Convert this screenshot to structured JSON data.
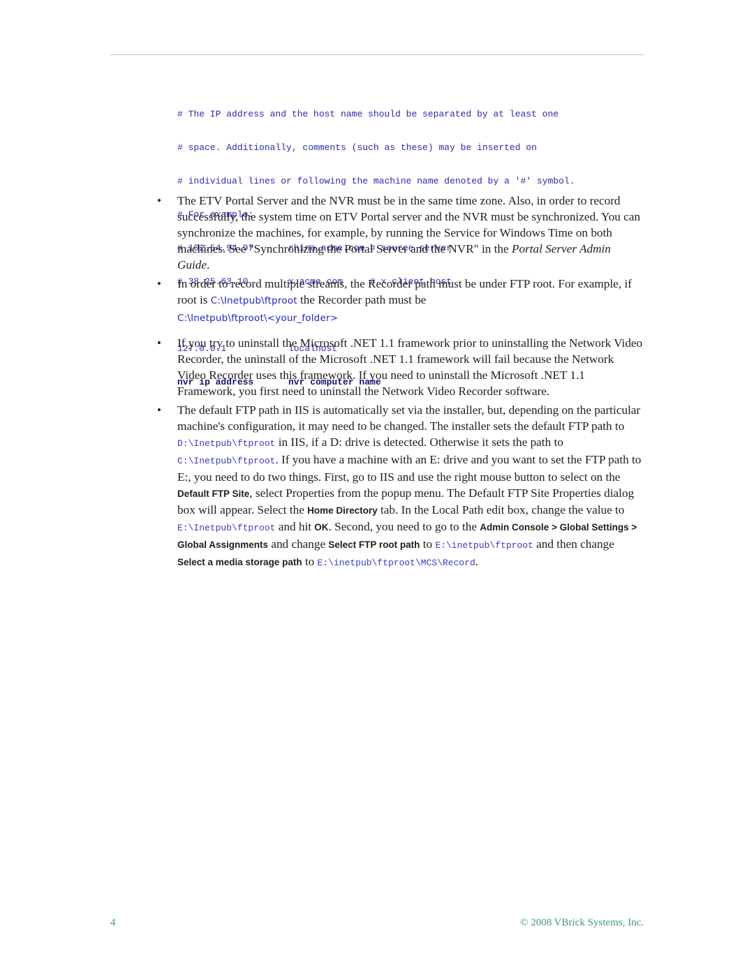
{
  "code_block": {
    "comment_lines": [
      "# The IP address and the host name should be separated by at least one",
      "# space. Additionally, comments (such as these) may be inserted on",
      "# individual lines or following the machine name denoted by a '#' symbol.",
      "# For example:"
    ],
    "example_rows": [
      {
        "ip": "# 102.54.94.97",
        "host": "rhino.acme.com # source server"
      },
      {
        "ip": "# 38.25.63.10",
        "host": "x.acme.com     # x client host"
      }
    ],
    "entries": [
      {
        "ip": "127.0.0.1",
        "host": "localhost"
      }
    ],
    "placeholder_row": {
      "ip": "nvr ip address",
      "host": "nvr computer name"
    }
  },
  "bullets": {
    "bullet_char": "•",
    "b1": {
      "text": "The ETV Portal Server and the NVR must be in the same time zone. Also, in order to record successfully, the system time on ETV Portal server and the NVR must be synchronized. You can synchronize the machines, for example, by running the Service for Windows Time on both machines. See \"Synchronizing the Portal Server and the NVR\" in the ",
      "italic": "Portal Server Admin Guide",
      "end": "."
    },
    "b2": {
      "t1": "In order to record multiple streams, the Recorder path must be under FTP root. For example, if root is ",
      "p1": "C:\\Inetpub\\ftproot",
      "t2": " the Recorder path must be ",
      "p2": "C:\\Inetpub\\ftproot\\<your_folder>"
    },
    "b3": {
      "text": "If you try to uninstall the Microsoft .NET 1.1 framework prior to uninstalling the Network Video Recorder, the uninstall of the Microsoft .NET 1.1 framework will fail because the Network Video Recorder uses this framework. If you need to uninstall the Microsoft .NET 1.1 Framework, you first need to uninstall the Network Video Recorder software."
    },
    "b4": {
      "t1": "The default FTP path in IIS is automatically set via the installer, but, depending on the particular machine's configuration, it may need to be changed. The installer sets the default FTP path to ",
      "p1": "D:\\Inetpub\\ftproot",
      "t2": " in IIS, if a D: drive is detected. Otherwise it sets the path to ",
      "p2": "C:\\Inetpub\\ftproot",
      "t3": ". If you have a machine with an E: drive and you want to set the FTP path to E:, you need to do two things. First, go to IIS and use the right mouse button to select on the ",
      "u1": "Default FTP Site",
      "t4": ", select Properties from the popup menu. The Default FTP Site Properties dialog box will appear. Select the ",
      "u2": "Home Directory",
      "t5": " tab. In the Local Path edit box, change the value to ",
      "p3": "E:\\Inetpub\\ftproot",
      "t6": " and hit ",
      "u3": "OK",
      "t7": ". Second, you need to go to the ",
      "u4": "Admin Console > Global Settings > Global Assignments",
      "t8": " and change ",
      "u5": "Select FTP root path",
      "t9": " to ",
      "p4": "E:\\inetpub\\ftproot",
      "t10": "  and then change ",
      "u6": "Select a media storage path",
      "t11": " to ",
      "p5": "E:\\inetpub\\ftproot\\MCS\\Record",
      "t12": "."
    }
  },
  "footer": {
    "page_number": "4",
    "copyright": "© 2008 VBrick Systems, Inc."
  },
  "colors": {
    "code_text": "#2a2ab0",
    "path_text": "#2424c8",
    "footer_text": "#3f9a6e",
    "header_rule": "#bdbdbd"
  }
}
